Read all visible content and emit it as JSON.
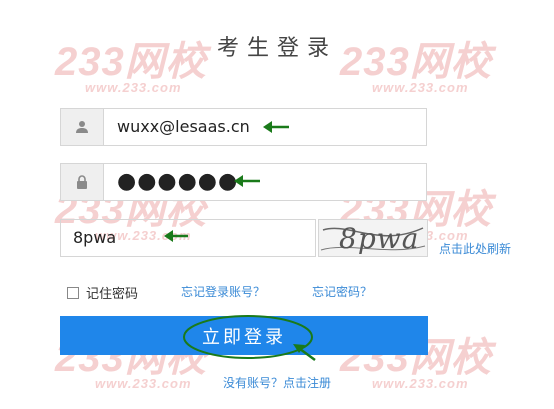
{
  "page": {
    "title": "考生登录"
  },
  "watermark": {
    "logo_text": "233网校",
    "sub_text": "www.233.com"
  },
  "form": {
    "username_value": "wuxx@lesaas.cn",
    "password_mask": "●●●●●●",
    "captcha_value": "8pwa",
    "captcha_image_text": "8pwa",
    "refresh_label": "点击此处刷新",
    "remember_label": "记住密码",
    "forgot_account_label": "忘记登录账号？",
    "forgot_password_label": "忘记密码？",
    "login_button_label": "立即登录",
    "register_label": "没有账号？点击注册"
  },
  "icons": {
    "username": "user-icon",
    "password": "lock-icon",
    "annotation": "green-arrow-icon"
  },
  "colors": {
    "accent_blue": "#1f86ea",
    "link_blue": "#3a8ad6",
    "annotation_green": "#1a7a1a",
    "watermark_pink": "#f5d0d0"
  }
}
